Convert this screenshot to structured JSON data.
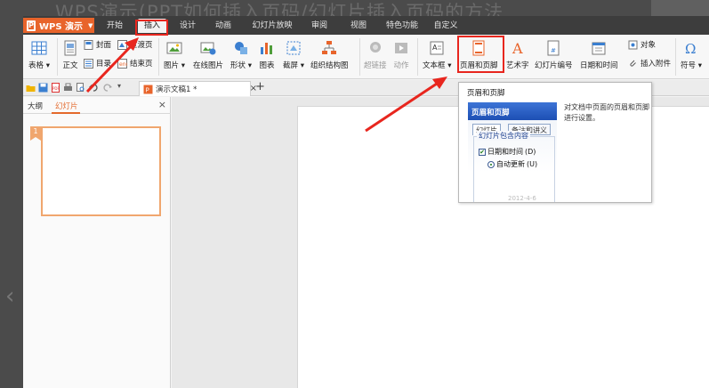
{
  "backdrop": {
    "title": "WPS演示(PPT如何插入页码/幻灯片插入页码的方法"
  },
  "app": {
    "menu": {
      "logo_label": "WPS 演示",
      "tabs": [
        "开始",
        "插入",
        "设计",
        "动画",
        "幻灯片放映",
        "审阅",
        "视图",
        "特色功能",
        "自定义"
      ],
      "active_tab": "插入"
    },
    "ribbon": {
      "table": "表格",
      "cover": "封面",
      "transition_page": "过渡页",
      "body_text": "正文",
      "toc": "目录",
      "end_page": "结束页",
      "picture": "图片",
      "online_picture": "在线图片",
      "shapes": "形状",
      "chart": "图表",
      "screenshot": "截屏",
      "org_chart": "组织结构图",
      "hyperlink": "超链接",
      "action": "动作",
      "textbox": "文本框",
      "header_footer": "页眉和页脚",
      "wordart": "艺术字",
      "slide_number": "幻灯片编号",
      "date_time": "日期和时间",
      "object": "对象",
      "insert_attachment": "插入附件",
      "symbol": "符号"
    },
    "doc_tab": {
      "label": "演示文稿1 *",
      "close": "×"
    },
    "new_tab": "+",
    "pane": {
      "tab_outline": "大纲",
      "tab_slides": "幻灯片",
      "close": "×",
      "slide_number": "1"
    },
    "tooltip": {
      "title": "页眉和页脚",
      "description": "对文档中页面的页眉和页脚进行设置。",
      "preview_header": "页眉和页脚",
      "preview_tab_slide": "幻灯片",
      "preview_tab_notes": "备注和讲义",
      "preview_group": "幻灯片包含内容",
      "preview_datetime": "日期和时间",
      "preview_datetime_key": "(D)",
      "preview_autoupdate": "自动更新",
      "preview_autoupdate_key": "(U)",
      "preview_date": "2012-4-6"
    }
  },
  "colors": {
    "accent": "#e8642b",
    "highlight": "#e8261e"
  }
}
